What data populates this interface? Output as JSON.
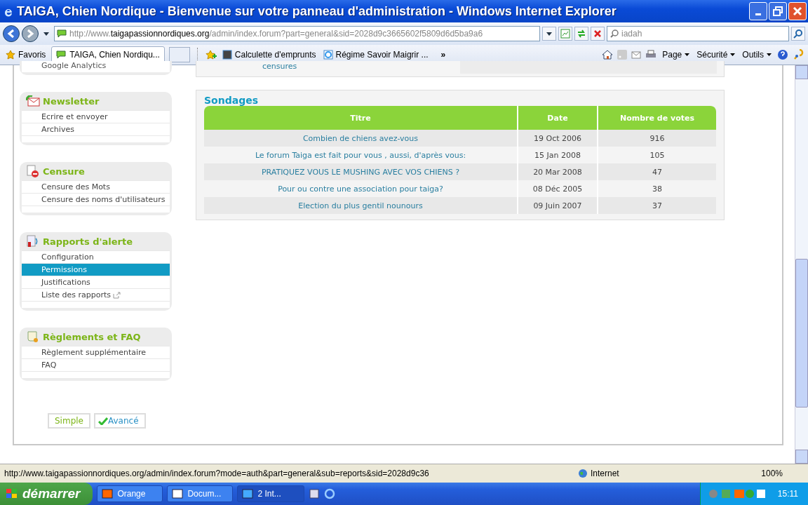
{
  "window": {
    "title": "TAIGA, Chien Nordique - Bienvenue sur votre panneau d'administration - Windows Internet Explorer"
  },
  "address_bar": {
    "scheme": "http://www.",
    "domain": "taigapassionnordiques.org",
    "path": "/admin/index.forum?part=general&sid=2028d9c3665602f5809d6d5ba9a6"
  },
  "search": {
    "value": "iadah"
  },
  "favorites_bar": {
    "favorites": "Favoris",
    "tabs": [
      {
        "label": "TAIGA, Chien Nordiqu...",
        "selected": true
      }
    ],
    "links": [
      "Calculette d'emprunts",
      "Régime Savoir Maigrir ..."
    ],
    "overflow": "»"
  },
  "command_bar": {
    "items": [
      "Page",
      "Sécurité",
      "Outils"
    ]
  },
  "sidebar": {
    "top_fragment": "Google Analytics",
    "sections": [
      {
        "title": "Newsletter",
        "items": [
          {
            "label": "Ecrire et envoyer",
            "selected": false,
            "external": false
          },
          {
            "label": "Archives",
            "selected": false,
            "external": false
          }
        ]
      },
      {
        "title": "Censure",
        "items": [
          {
            "label": "Censure des Mots",
            "selected": false,
            "external": false
          },
          {
            "label": "Censure des noms d'utilisateurs",
            "selected": false,
            "external": false
          }
        ]
      },
      {
        "title": "Rapports d'alerte",
        "items": [
          {
            "label": "Configuration",
            "selected": false,
            "external": false
          },
          {
            "label": "Permissions",
            "selected": true,
            "external": false
          },
          {
            "label": "Justifications",
            "selected": false,
            "external": false
          },
          {
            "label": "Liste des rapports",
            "selected": false,
            "external": true
          }
        ]
      },
      {
        "title": "Règlements et FAQ",
        "items": [
          {
            "label": "Règlement supplémentaire",
            "selected": false,
            "external": false
          },
          {
            "label": "FAQ",
            "selected": false,
            "external": false
          }
        ]
      }
    ],
    "modes": [
      {
        "label": "Simple",
        "selected": false
      },
      {
        "label": "Avancé",
        "selected": true
      }
    ]
  },
  "main": {
    "top_fragment": "censures",
    "polls": {
      "title": "Sondages",
      "columns": [
        "Titre",
        "Date",
        "Nombre de votes"
      ],
      "rows": [
        [
          "Combien de chiens avez-vous",
          "19 Oct 2006",
          "916"
        ],
        [
          "Le forum Taiga est fait pour vous , aussi, d'après vous:",
          "15 Jan 2008",
          "105"
        ],
        [
          "PRATIQUEZ VOUS LE MUSHING AVEC VOS CHIENS ?",
          "20 Mar 2008",
          "47"
        ],
        [
          "Pour ou contre une association pour taiga?",
          "08 Déc 2005",
          "38"
        ],
        [
          "Election du plus gentil nounours",
          "09 Juin 2007",
          "37"
        ]
      ]
    }
  },
  "status_bar": {
    "url": "http://www.taigapassionnordiques.org/admin/index.forum?mode=auth&part=general&sub=reports&sid=2028d9c36",
    "zone": "Internet",
    "zoom": "100%"
  },
  "taskbar": {
    "start": "démarrer",
    "tasks": [
      {
        "label": "Orange",
        "selected": false
      },
      {
        "label": "Docum...",
        "selected": false
      },
      {
        "label": "2 Int...",
        "selected": true
      }
    ],
    "clock": "15:11"
  }
}
